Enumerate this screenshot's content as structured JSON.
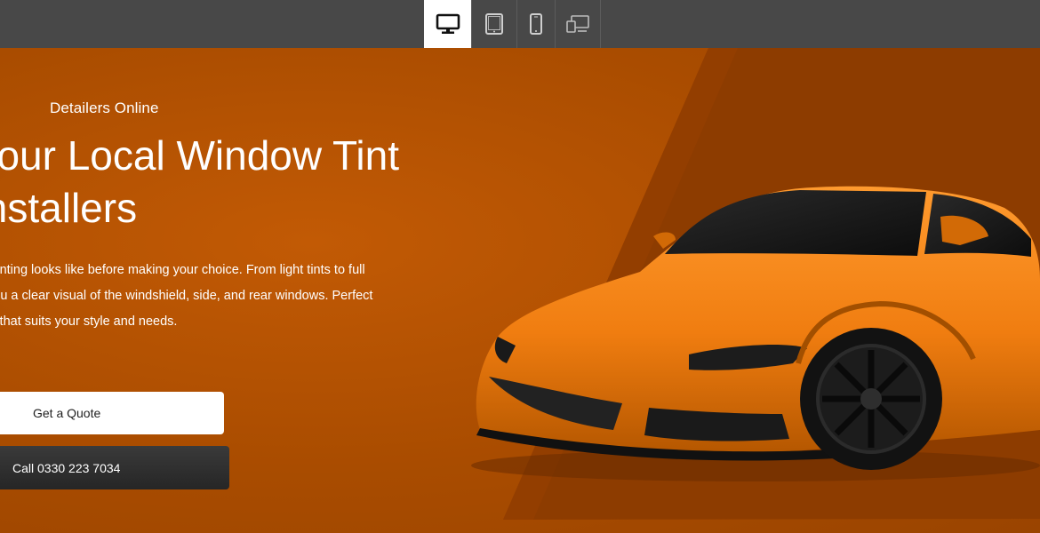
{
  "toolbar": {
    "devices": [
      {
        "name": "desktop-icon",
        "active": true
      },
      {
        "name": "tablet-icon",
        "active": false
      },
      {
        "name": "mobile-icon",
        "active": false
      },
      {
        "name": "responsive-icon",
        "active": false
      }
    ]
  },
  "hero": {
    "brand": "Detailers Online",
    "headline": "Your Local Window Tint Installers",
    "description": "See what each level of window tinting looks like before making your choice. From light tints to full privacy glass, our demo gives you a clear visual of the windshield, side, and rear windows. Perfect for making an informed decision that suits your style and needs.",
    "quote_button": "Get a Quote",
    "call_button": "Call 0330 223 7034"
  },
  "colors": {
    "toolbar": "#484848",
    "hero_background": "#a84d00",
    "accent_stripe": "#8a3a00",
    "car_body": "#f07d10",
    "button_light": "#ffffff",
    "button_dark": "#2f2f2f"
  }
}
